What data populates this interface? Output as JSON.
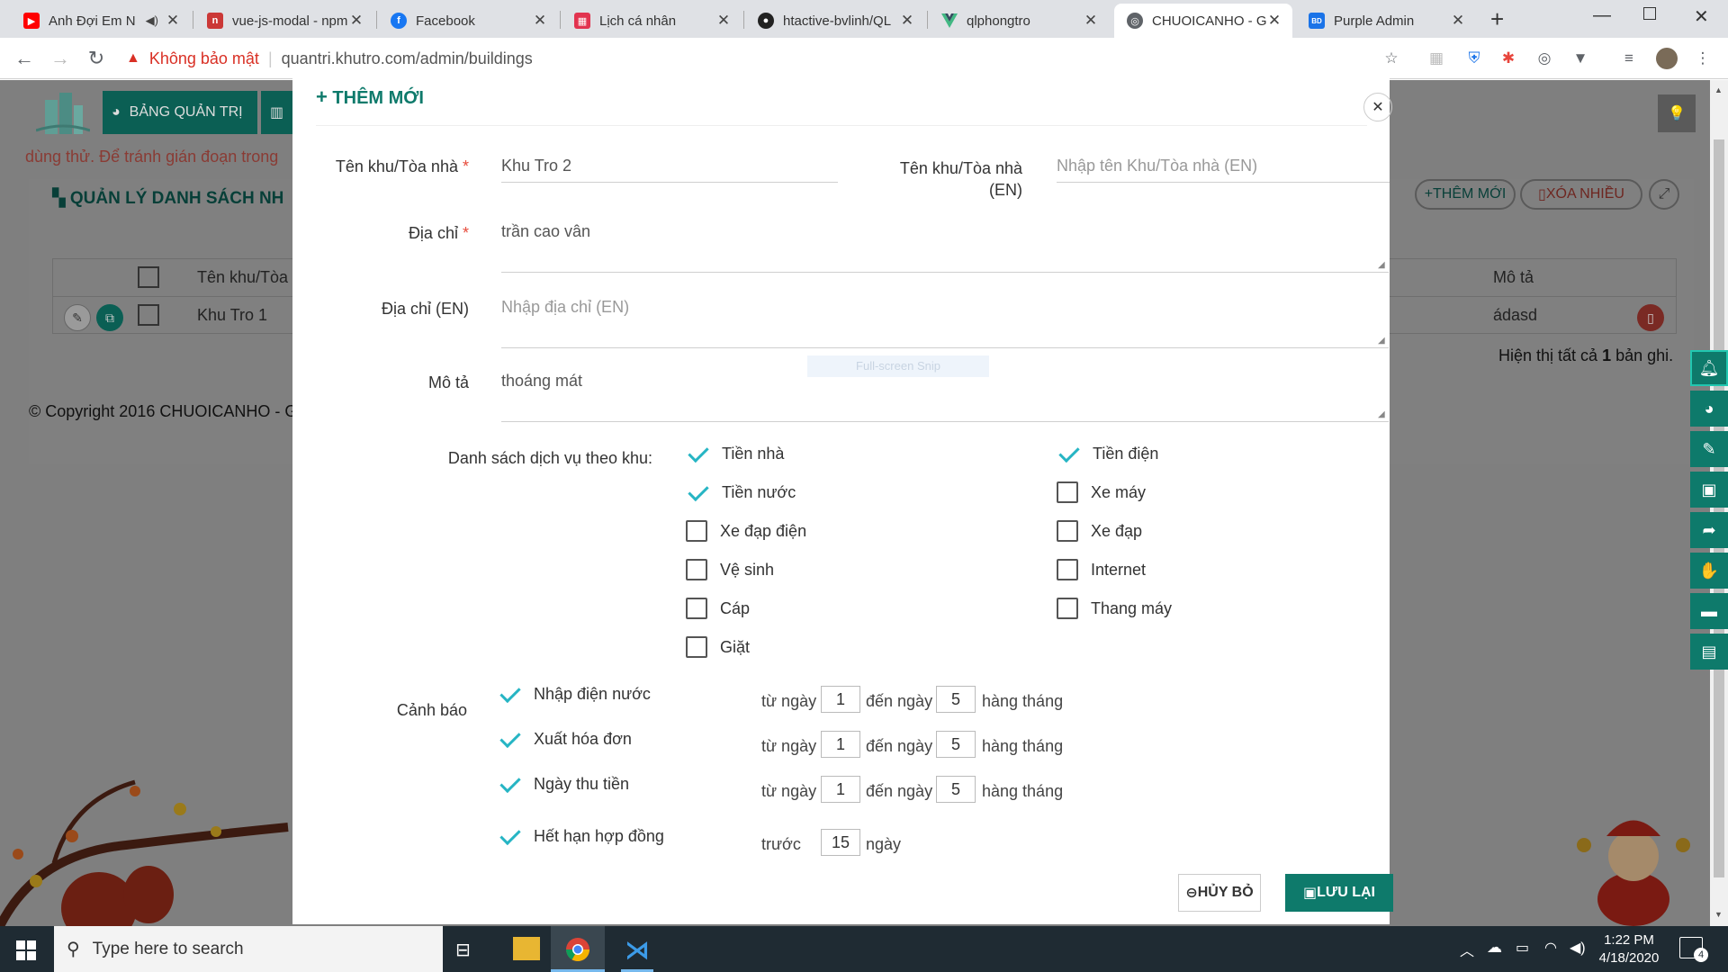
{
  "browser": {
    "tabs": [
      {
        "title": "Anh Đợi Em N",
        "icon": "youtube-icon",
        "color": "#ff0000"
      },
      {
        "title": "vue-js-modal - npm",
        "icon": "npm-icon",
        "color": "#cb3837"
      },
      {
        "title": "Facebook",
        "icon": "facebook-icon",
        "color": "#1877f2"
      },
      {
        "title": "Lịch cá nhân",
        "icon": "calendar-icon",
        "color": "#e2334f"
      },
      {
        "title": "htactive-bvlinh/QL",
        "icon": "github-icon",
        "color": "#222222"
      },
      {
        "title": "qlphongtro",
        "icon": "vue-icon",
        "color": "#41b883"
      },
      {
        "title": "CHUOICANHO - G",
        "icon": "globe-icon",
        "color": "#5f6368"
      },
      {
        "title": "Purple Admin",
        "icon": "bd-icon",
        "color": "#1a73e8"
      }
    ],
    "new_tab": "+",
    "security_label": "Không bảo mật",
    "url": "quantri.khutro.com/admin/buildings"
  },
  "background": {
    "nav_dashboard": "BẢNG QUẢN TRỊ",
    "notice": "dùng thử. Để tránh gián đoạn trong",
    "panel_title": "QUẢN LÝ DANH SÁCH NH",
    "add_new": "THÊM MỚI",
    "delete_many": "XÓA NHIỀU",
    "col_name": "Tên khu/Tòa",
    "col_desc": "Mô tả",
    "row_name": "Khu Tro 1",
    "row_desc": "ádasd",
    "summary_prefix": "Hiện thị tất cả ",
    "summary_count": "1",
    "summary_suffix": " bản ghi.",
    "copyright": "© Copyright 2016 CHUOICANHO - G",
    "snip_hint": "Full-screen Snip"
  },
  "modal": {
    "title": "THÊM MỚI",
    "name_label": "Tên khu/Tòa nhà",
    "name_value": "Khu Tro 2",
    "name_en_label_1": "Tên khu/Tòa nhà",
    "name_en_label_2": "(EN)",
    "name_en_placeholder": "Nhập tên Khu/Tòa nhà (EN)",
    "address_label": "Địa chỉ",
    "address_value": "trần cao vân",
    "address_en_label": "Địa chỉ (EN)",
    "address_en_placeholder": "Nhập địa chỉ (EN)",
    "desc_label": "Mô tả",
    "desc_value": "thoáng mát",
    "services_label": "Danh sách dịch vụ theo khu:",
    "services_left": [
      {
        "label": "Tiền nhà",
        "checked": true
      },
      {
        "label": "Tiền nước",
        "checked": true
      },
      {
        "label": "Xe đạp điện",
        "checked": false
      },
      {
        "label": "Vệ sinh",
        "checked": false
      },
      {
        "label": "Cáp",
        "checked": false
      },
      {
        "label": "Giặt",
        "checked": false
      }
    ],
    "services_right": [
      {
        "label": "Tiền điện",
        "checked": true
      },
      {
        "label": "Xe máy",
        "checked": false
      },
      {
        "label": "Xe đạp",
        "checked": false
      },
      {
        "label": "Internet",
        "checked": false
      },
      {
        "label": "Thang máy",
        "checked": false
      }
    ],
    "warning_label": "Cảnh báo",
    "warnings": [
      {
        "label": "Nhập điện nước",
        "from_text": "từ ngày",
        "from": "1",
        "to_text": "đến ngày",
        "to": "5",
        "suffix": "hàng tháng"
      },
      {
        "label": "Xuất hóa đơn",
        "from_text": "từ ngày",
        "from": "1",
        "to_text": "đến ngày",
        "to": "5",
        "suffix": "hàng tháng"
      },
      {
        "label": "Ngày thu tiền",
        "from_text": "từ ngày",
        "from": "1",
        "to_text": "đến ngày",
        "to": "5",
        "suffix": "hàng tháng"
      }
    ],
    "expiry": {
      "label": "Hết hạn hợp đồng",
      "before_text": "trước",
      "days": "15",
      "days_text": "ngày"
    },
    "cancel_label": "HỦY BỎ",
    "save_label": "LƯU LẠI"
  },
  "taskbar": {
    "search_placeholder": "Type here to search",
    "time": "1:22 PM",
    "date": "4/18/2020",
    "notifications": "4"
  },
  "colors": {
    "accent": "#0e7a6b",
    "check": "#26b5c4",
    "required": "#e74c3c",
    "danger": "#e74c3c"
  }
}
